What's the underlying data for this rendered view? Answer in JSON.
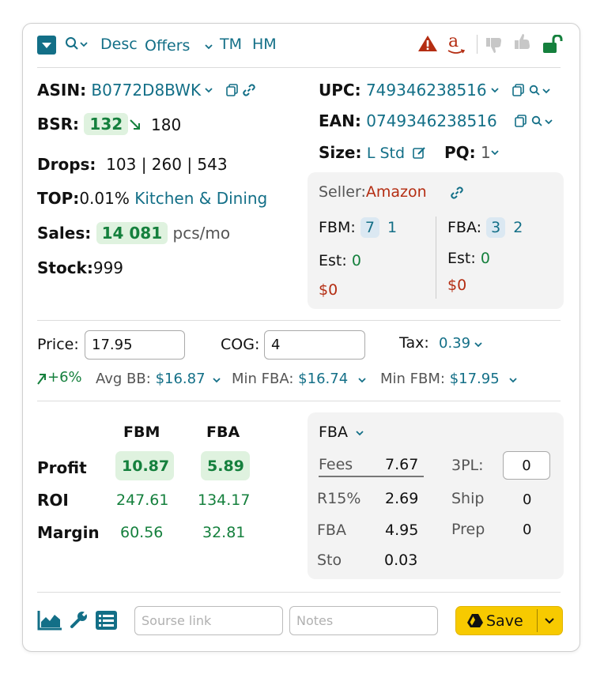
{
  "toolbar": {
    "search_chev": "Q",
    "desc": "Desc",
    "offers": "Offers",
    "tm": "TM",
    "hm": "HM"
  },
  "product": {
    "asin_label": "ASIN:",
    "asin": "B0772D8BWK",
    "upc_label": "UPC:",
    "upc": "749346238516",
    "ean_label": "EAN:",
    "ean": "0749346238516",
    "bsr_label": "BSR:",
    "bsr": "132",
    "bsr_prev": "180",
    "size_label": "Size:",
    "size": "L Std",
    "pq_label": "PQ:",
    "pq": "1",
    "drops_label": "Drops:",
    "drops": "103 | 260 | 543",
    "top_label": "TOP:",
    "top_pct": "0.01%",
    "top_category": "Kitchen & Dining",
    "sales_label": "Sales:",
    "sales": "14 081",
    "sales_unit": "pcs/mo",
    "stock_label": "Stock:",
    "stock": "999"
  },
  "seller": {
    "label": "Seller:",
    "name": "Amazon",
    "fbm_label": "FBM:",
    "fbm_count": "7",
    "fbm_count2": "1",
    "fba_label": "FBA:",
    "fba_count": "3",
    "fba_count2": "2",
    "est_label": "Est:",
    "fbm_est": "0",
    "fba_est": "0",
    "fbm_money": "$0",
    "fba_money": "$0"
  },
  "pricing": {
    "price_label": "Price:",
    "price": "17.95",
    "cog_label": "COG:",
    "cog": "4",
    "tax_label": "Tax:",
    "tax": "0.39",
    "change": "+6%",
    "avg_bb_label": "Avg BB:",
    "avg_bb": "$16.87",
    "min_fba_label": "Min FBA:",
    "min_fba": "$16.74",
    "min_fbm_label": "Min FBM:",
    "min_fbm": "$17.95"
  },
  "profit": {
    "col_fbm": "FBM",
    "col_fba": "FBA",
    "rows": [
      {
        "label": "Profit",
        "fbm": "10.87",
        "fba": "5.89"
      },
      {
        "label": "ROI",
        "fbm": "247.61",
        "fba": "134.17"
      },
      {
        "label": "Margin",
        "fbm": "60.56",
        "fba": "32.81"
      }
    ]
  },
  "fees": {
    "mode": "FBA",
    "fees_label": "Fees",
    "fees": "7.67",
    "r15_label": "R15%",
    "r15": "2.69",
    "fba_label": "FBA",
    "fba": "4.95",
    "sto_label": "Sto",
    "sto": "0.03",
    "tpl_label": "3PL:",
    "tpl": "0",
    "ship_label": "Ship",
    "ship": "0",
    "prep_label": "Prep",
    "prep": "0"
  },
  "footer": {
    "source_placeholder": "Sourse link",
    "notes_placeholder": "Notes",
    "save_label": "Save"
  },
  "colors": {
    "teal": "#136f87",
    "green": "#15803d",
    "red": "#b42d12",
    "save": "#f7ca00"
  }
}
